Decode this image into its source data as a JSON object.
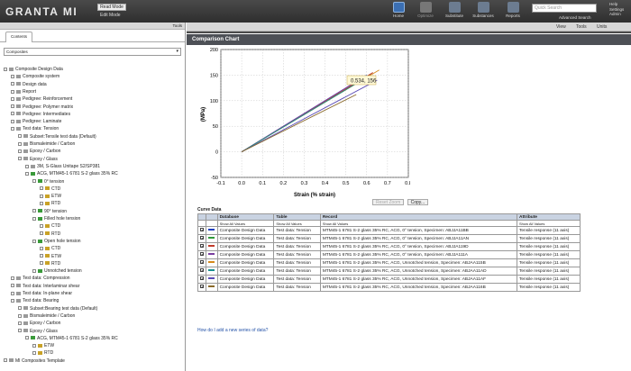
{
  "header": {
    "logo": "GRANTA MI",
    "mode_button": "Read Mode",
    "mode_edit": "Edit Mode",
    "buttons": [
      {
        "label": "Home",
        "icon": "home-icon",
        "state": "active"
      },
      {
        "label": "Optimize",
        "icon": "optimize-icon",
        "state": "dim"
      },
      {
        "label": "Substitute",
        "icon": "substitute-icon",
        "state": "normal"
      },
      {
        "label": "Substances",
        "icon": "substances-icon",
        "state": "normal"
      },
      {
        "label": "Reports",
        "icon": "reports-icon",
        "state": "normal"
      }
    ],
    "search_placeholder": "Quick Search",
    "advanced_search": "Advanced Search",
    "help": "Help",
    "settings": "Settings",
    "admin": "Admin"
  },
  "left_panel": {
    "tools": "Tools",
    "tab": "Contents",
    "dropdown": "Composites",
    "tree": [
      {
        "label": "Composite Design Data",
        "level": 0,
        "icon": "db"
      },
      {
        "label": "Composite system",
        "level": 1,
        "icon": "folder"
      },
      {
        "label": "Design data",
        "level": 1,
        "icon": "folder"
      },
      {
        "label": "Report",
        "level": 1,
        "icon": "folder"
      },
      {
        "label": "Pedigree: Reinforcement",
        "level": 1,
        "icon": "folder"
      },
      {
        "label": "Pedigree: Polymer matrix",
        "level": 1,
        "icon": "folder"
      },
      {
        "label": "Pedigree: Intermediates",
        "level": 1,
        "icon": "folder"
      },
      {
        "label": "Pedigree: Laminate",
        "level": 1,
        "icon": "folder"
      },
      {
        "label": "Test data: Tension",
        "level": 1,
        "icon": "folder"
      },
      {
        "label": "Subset:Tensile test data (Default)",
        "level": 2,
        "icon": "filter"
      },
      {
        "label": "Bismaleimide / Carbon",
        "level": 2,
        "icon": "folder"
      },
      {
        "label": "Epoxy / Carbon",
        "level": 2,
        "icon": "folder"
      },
      {
        "label": "Epoxy / Glass",
        "level": 2,
        "icon": "folder"
      },
      {
        "label": "3M, S-Glass Unitape S2/SP381",
        "level": 3,
        "icon": "folder"
      },
      {
        "label": "ACG, MTM45-1 6781 S-2 glass 35% RC",
        "level": 3,
        "icon": "green"
      },
      {
        "label": "0° tension",
        "level": 4,
        "icon": "green"
      },
      {
        "label": "CTD",
        "level": 5,
        "icon": "rec"
      },
      {
        "label": "ETW",
        "level": 5,
        "icon": "rec"
      },
      {
        "label": "RTD",
        "level": 5,
        "icon": "rec"
      },
      {
        "label": "90° tension",
        "level": 4,
        "icon": "green"
      },
      {
        "label": "Filled hole tension",
        "level": 4,
        "icon": "green"
      },
      {
        "label": "CTD",
        "level": 5,
        "icon": "rec"
      },
      {
        "label": "RTD",
        "level": 5,
        "icon": "rec"
      },
      {
        "label": "Open hole tension",
        "level": 4,
        "icon": "green"
      },
      {
        "label": "CTD",
        "level": 5,
        "icon": "rec"
      },
      {
        "label": "ETW",
        "level": 5,
        "icon": "rec"
      },
      {
        "label": "RTD",
        "level": 5,
        "icon": "rec"
      },
      {
        "label": "Unnotched tension",
        "level": 4,
        "icon": "green"
      },
      {
        "label": "Test data: Compression",
        "level": 1,
        "icon": "folder"
      },
      {
        "label": "Test data: Interlaminar shear",
        "level": 1,
        "icon": "folder"
      },
      {
        "label": "Test data: In-plane shear",
        "level": 1,
        "icon": "folder"
      },
      {
        "label": "Test data: Bearing",
        "level": 1,
        "icon": "folder"
      },
      {
        "label": "Subset:Bearing test data (Default)",
        "level": 2,
        "icon": "filter"
      },
      {
        "label": "Bismaleimide / Carbon",
        "level": 2,
        "icon": "folder"
      },
      {
        "label": "Epoxy / Carbon",
        "level": 2,
        "icon": "folder"
      },
      {
        "label": "Epoxy / Glass",
        "level": 2,
        "icon": "folder"
      },
      {
        "label": "ACG, MTM45-1 6781 S-2 glass 35% RC",
        "level": 3,
        "icon": "green"
      },
      {
        "label": "ETW",
        "level": 4,
        "icon": "rec"
      },
      {
        "label": "RTD",
        "level": 4,
        "icon": "rec"
      },
      {
        "label": "MI Composites Template",
        "level": 0,
        "icon": "db"
      }
    ]
  },
  "main": {
    "links": [
      "View",
      "Tools",
      "Units"
    ],
    "title": "Comparison Chart",
    "tooltip": "0.534, 156",
    "reset_zoom": "Reset Zoom",
    "copy": "Copy...",
    "curve_data_label": "Curve Data",
    "columns": [
      "Database",
      "Table",
      "Record",
      "Attribute"
    ],
    "filter": "Show All Values",
    "rows": [
      {
        "color": "#1f3fbf",
        "db": "Composite Design Data",
        "table": "Test data: Tension",
        "record": "MTM45-1 6781 S-2 glass 35% RC, ACG, 0° tension, Specimen: ABJJA11BB",
        "attr": "Tensile response (11 axis)"
      },
      {
        "color": "#2f9a3a",
        "db": "Composite Design Data",
        "table": "Test data: Tension",
        "record": "MTM45-1 6781 S-2 glass 35% RC, ACG, 0° tension, Specimen: ABJJA11AN",
        "attr": "Tensile response (11 axis)"
      },
      {
        "color": "#c23b2b",
        "db": "Composite Design Data",
        "table": "Test data: Tension",
        "record": "MTM45-1 6781 S-2 glass 35% RC, ACG, 0° tension, Specimen: ABJJA119D",
        "attr": "Tensile response (11 axis)"
      },
      {
        "color": "#7a3fa0",
        "db": "Composite Design Data",
        "table": "Test data: Tension",
        "record": "MTM45-1 6781 S-2 glass 35% RC, ACG, 0° tension, Specimen: ABJJA111A",
        "attr": "Tensile response (11 axis)"
      },
      {
        "color": "#d58a1c",
        "db": "Composite Design Data",
        "table": "Test data: Tension",
        "record": "MTM45-1 6781 S-2 glass 35% RC, ACG, Unnotched tension, Specimen: ABJAA115B",
        "attr": "Tensile response (11 axis)"
      },
      {
        "color": "#1a8f8f",
        "db": "Composite Design Data",
        "table": "Test data: Tension",
        "record": "MTM45-1 6781 S-2 glass 35% RC, ACG, Unnotched tension, Specimen: ABJAA11AD",
        "attr": "Tensile response (11 axis)"
      },
      {
        "color": "#5a4ab5",
        "db": "Composite Design Data",
        "table": "Test data: Tension",
        "record": "MTM45-1 6781 S-2 glass 35% RC, ACG, Unnotched tension, Specimen: ABJAA11AF",
        "attr": "Tensile response (11 axis)"
      },
      {
        "color": "#8a6a2a",
        "db": "Composite Design Data",
        "table": "Test data: Tension",
        "record": "MTM45-1 6781 S-2 glass 35% RC, ACG, Unnotched tension, Specimen: ABJAA116B",
        "attr": "Tensile response (11 axis)"
      }
    ],
    "help_link": "How do I add a new series of data?"
  },
  "chart_data": {
    "type": "line",
    "xlabel": "Strain (% strain)",
    "ylabel": "(MPa)",
    "xlim": [
      -0.1,
      0.8
    ],
    "ylim": [
      -50,
      200
    ],
    "xticks": [
      "-0.1",
      "0.0",
      "0.1",
      "0.2",
      "0.3",
      "0.4",
      "0.5",
      "0.6",
      "0.7",
      "0.8"
    ],
    "yticks": [
      "200",
      "150",
      "100",
      "50",
      "0",
      "-50"
    ],
    "grid": true,
    "series": [
      {
        "color": "#1f3fbf",
        "x": [
          0,
          0.6
        ],
        "y": [
          0,
          150
        ]
      },
      {
        "color": "#2f9a3a",
        "x": [
          0,
          0.62
        ],
        "y": [
          0,
          152
        ]
      },
      {
        "color": "#c23b2b",
        "x": [
          0,
          0.63
        ],
        "y": [
          0,
          155
        ]
      },
      {
        "color": "#7a3fa0",
        "x": [
          0,
          0.58
        ],
        "y": [
          0,
          145
        ]
      },
      {
        "color": "#d58a1c",
        "x": [
          0,
          0.66
        ],
        "y": [
          0,
          160
        ]
      },
      {
        "color": "#1a8f8f",
        "x": [
          0,
          0.61
        ],
        "y": [
          0,
          148
        ]
      },
      {
        "color": "#5a4ab5",
        "x": [
          0,
          0.65
        ],
        "y": [
          0,
          140
        ]
      },
      {
        "color": "#8a6a2a",
        "x": [
          0,
          0.55
        ],
        "y": [
          0,
          112
        ]
      }
    ]
  }
}
